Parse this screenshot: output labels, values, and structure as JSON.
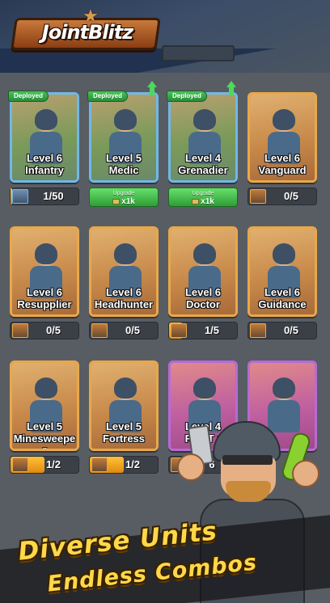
{
  "app": {
    "logo_text": "JointBlitz"
  },
  "cards": [
    {
      "level": "Level 6",
      "name": "Infantry",
      "frame": "blue",
      "deployed": true,
      "upgrade_arrow": false,
      "status": {
        "kind": "progress",
        "text": "1/50",
        "fill": 0.02
      }
    },
    {
      "level": "Level 5",
      "name": "Medic",
      "frame": "blue",
      "deployed": true,
      "upgrade_arrow": true,
      "status": {
        "kind": "upgrade",
        "label": "Upgrade",
        "cost": "x1k"
      }
    },
    {
      "level": "Level 4",
      "name": "Grenadier",
      "frame": "blue",
      "deployed": true,
      "upgrade_arrow": true,
      "status": {
        "kind": "upgrade",
        "label": "Upgrade",
        "cost": "x1k"
      }
    },
    {
      "level": "Level 6",
      "name": "Vanguard",
      "frame": "gold",
      "deployed": false,
      "upgrade_arrow": false,
      "status": {
        "kind": "progress",
        "text": "0/5",
        "fill": 0
      }
    },
    {
      "level": "Level 6",
      "name": "Resupplier",
      "frame": "gold",
      "deployed": false,
      "upgrade_arrow": false,
      "status": {
        "kind": "progress",
        "text": "0/5",
        "fill": 0
      }
    },
    {
      "level": "Level 6",
      "name": "Headhunter",
      "frame": "gold",
      "deployed": false,
      "upgrade_arrow": false,
      "status": {
        "kind": "progress",
        "text": "0/5",
        "fill": 0
      }
    },
    {
      "level": "Level 6",
      "name": "Doctor",
      "frame": "gold",
      "deployed": false,
      "upgrade_arrow": false,
      "status": {
        "kind": "progress",
        "text": "1/5",
        "fill": 0.2
      }
    },
    {
      "level": "Level 6",
      "name": "Guidance",
      "frame": "gold",
      "deployed": false,
      "upgrade_arrow": false,
      "status": {
        "kind": "progress",
        "text": "0/5",
        "fill": 0
      }
    },
    {
      "level": "Level 5",
      "name": "Minesweepe r",
      "frame": "gold",
      "deployed": false,
      "upgrade_arrow": false,
      "status": {
        "kind": "progress",
        "text": "1/2",
        "fill": 0.5
      }
    },
    {
      "level": "Level 5",
      "name": "Fortress",
      "frame": "gold",
      "deployed": false,
      "upgrade_arrow": false,
      "status": {
        "kind": "progress",
        "text": "1/2",
        "fill": 0.5
      }
    },
    {
      "level": "Level 4",
      "name": "R   et T   r",
      "frame": "purple",
      "deployed": false,
      "upgrade_arrow": false,
      "status": {
        "kind": "progress",
        "text": "6",
        "fill": 0
      }
    },
    {
      "level": "",
      "name": "",
      "frame": "purple",
      "deployed": false,
      "upgrade_arrow": false,
      "status": {
        "kind": "none"
      }
    }
  ],
  "deployed_label": "Deployed",
  "tagline": {
    "line1": "Diverse Units",
    "line2": "Endless Combos"
  },
  "colors": {
    "gold_frame": "#e8a84a",
    "blue_frame": "#6fb8e8",
    "purple_frame": "#b66ad6",
    "deployed_green": "#2a8c38",
    "tagline_yellow": "#ffd84a"
  }
}
